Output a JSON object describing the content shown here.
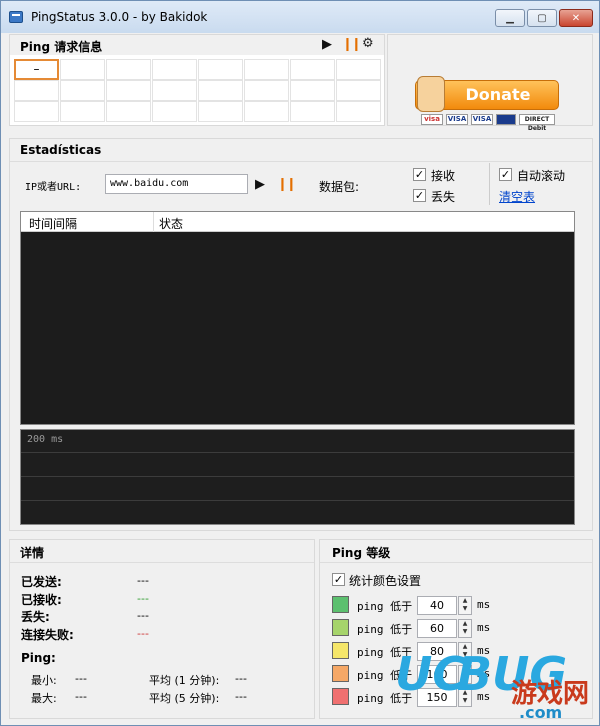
{
  "window": {
    "title": "PingStatus 3.0.0 - by Bakidok"
  },
  "ping_info": {
    "title": "Ping 请求信息",
    "grid_rows": 3,
    "grid_cols": 8,
    "selected_cell_value": "–"
  },
  "donate": {
    "label": "Donate",
    "cards": [
      "visa",
      "VISA",
      "VISA",
      "DIRECT Debit"
    ]
  },
  "stats": {
    "title": "Estadísticas",
    "url_label": "IP或者URL:",
    "url_value": "www.baidu.com",
    "packets_label": "数据包:",
    "check_receive": "接收",
    "check_lost": "丢失",
    "check_autoscroll": "自动滚动",
    "clear_link": "清空表"
  },
  "table": {
    "columns": [
      "时间间隔",
      "状态"
    ]
  },
  "graph": {
    "label": "200 ms"
  },
  "details": {
    "title": "详情",
    "sent_label": "已发送:",
    "sent_value": "---",
    "received_label": "已接收:",
    "received_value": "---",
    "lost_label": "丢失:",
    "lost_value": "---",
    "failed_label": "连接失败:",
    "failed_value": "---",
    "ping_label": "Ping:",
    "min_label": "最小:",
    "min_value": "---",
    "max_label": "最大:",
    "max_value": "---",
    "avg1_label": "平均 (1 分钟):",
    "avg1_value": "---",
    "avg5_label": "平均 (5 分钟):",
    "avg5_value": "---"
  },
  "ping_levels": {
    "title": "Ping 等级",
    "color_setting_label": "统计颜色设置",
    "rows": [
      {
        "text": "ping 低于",
        "value": "40",
        "unit": "ms",
        "color": "#5cc06f"
      },
      {
        "text": "ping 低于",
        "value": "60",
        "unit": "ms",
        "color": "#a6d46b"
      },
      {
        "text": "ping 低于",
        "value": "80",
        "unit": "ms",
        "color": "#f5e66a"
      },
      {
        "text": "ping 低于",
        "value": "100",
        "unit": "ms",
        "color": "#f5a867"
      },
      {
        "text": "ping 低于",
        "value": "150",
        "unit": "ms",
        "color": "#f07070"
      }
    ]
  },
  "watermark": {
    "brand_uc": "UC",
    "brand_bug": "BUG",
    "cn": "游戏网",
    "domain": ".com"
  }
}
